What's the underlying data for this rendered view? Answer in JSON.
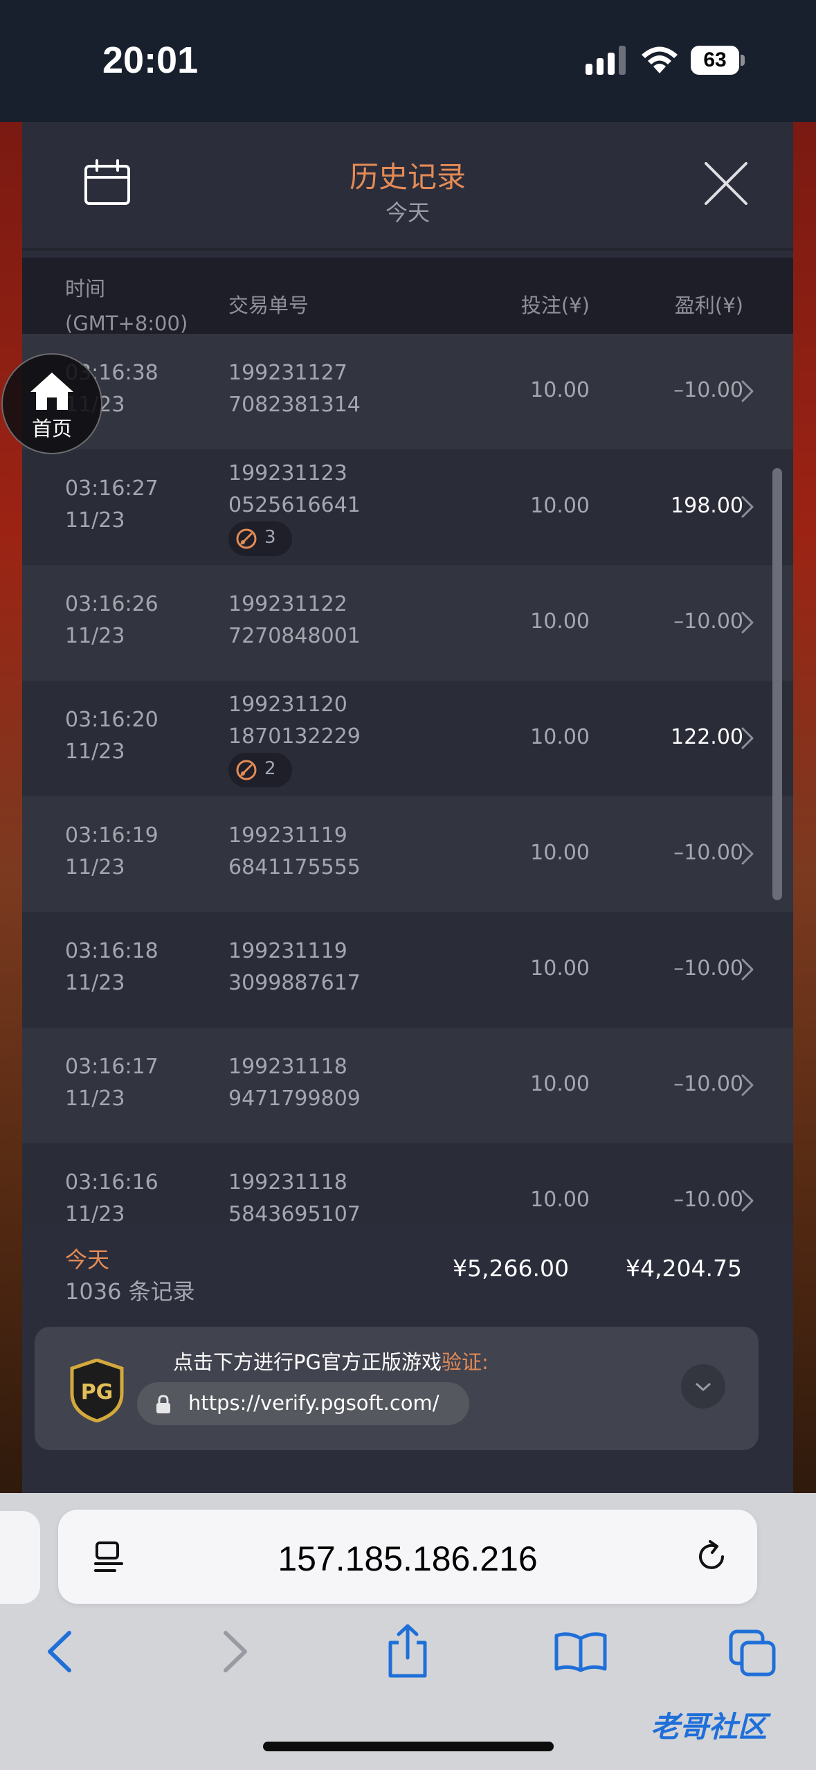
{
  "status_bar": {
    "time": "20:01",
    "battery": "63"
  },
  "header": {
    "title": "历史记录",
    "subtitle": "今天"
  },
  "columns": {
    "time": "时间",
    "timezone": "(GMT+8:00)",
    "order_id": "交易单号",
    "bet": "投注(¥)",
    "profit": "盈利(¥)"
  },
  "rows": [
    {
      "time": "03:16:38",
      "date": "11/23",
      "id1": "199231127",
      "id2": "7082381314",
      "bet": "10.00",
      "profit": "–10.00",
      "badge": ""
    },
    {
      "time": "03:16:27",
      "date": "11/23",
      "id1": "199231123",
      "id2": "0525616641",
      "bet": "10.00",
      "profit": "198.00",
      "badge": "3"
    },
    {
      "time": "03:16:26",
      "date": "11/23",
      "id1": "199231122",
      "id2": "7270848001",
      "bet": "10.00",
      "profit": "–10.00",
      "badge": ""
    },
    {
      "time": "03:16:20",
      "date": "11/23",
      "id1": "199231120",
      "id2": "1870132229",
      "bet": "10.00",
      "profit": "122.00",
      "badge": "2"
    },
    {
      "time": "03:16:19",
      "date": "11/23",
      "id1": "199231119",
      "id2": "6841175555",
      "bet": "10.00",
      "profit": "–10.00",
      "badge": ""
    },
    {
      "time": "03:16:18",
      "date": "11/23",
      "id1": "199231119",
      "id2": "3099887617",
      "bet": "10.00",
      "profit": "–10.00",
      "badge": ""
    },
    {
      "time": "03:16:17",
      "date": "11/23",
      "id1": "199231118",
      "id2": "9471799809",
      "bet": "10.00",
      "profit": "–10.00",
      "badge": ""
    },
    {
      "time": "03:16:16",
      "date": "11/23",
      "id1": "199231118",
      "id2": "5843695107",
      "bet": "10.00",
      "profit": "–10.00",
      "badge": ""
    }
  ],
  "footer": {
    "period": "今天",
    "count": "1036 条记录",
    "total_bet": "¥5,266.00",
    "total_profit": "¥4,204.75"
  },
  "verify": {
    "text": "点击下方进行PG官方正版游戏",
    "highlight": "验证:",
    "url": "https://verify.pgsoft.com/",
    "logo": "PG"
  },
  "home_button": {
    "label": "首页"
  },
  "browser": {
    "address": "157.185.186.216"
  },
  "watermark": "老哥社区",
  "icons": {
    "calendar": "calendar-icon",
    "close": "close-icon",
    "chevron": "chevron-right-icon",
    "lock": "lock-icon",
    "home": "home-icon"
  },
  "colors": {
    "accent": "#e48b55",
    "panel": "#2b2d3b",
    "row_alt": "#32343f",
    "browser_blue": "#1f6fd9"
  }
}
